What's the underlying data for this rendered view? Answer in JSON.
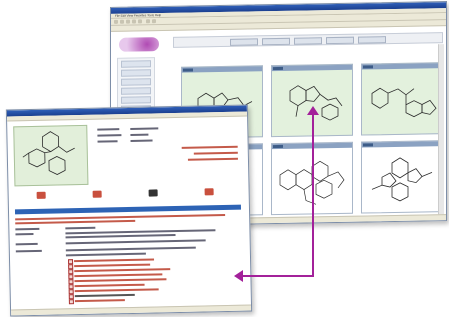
{
  "back_window": {
    "menu": "File   Edit   View   Favorites   Tools   Help"
  },
  "front_window": {},
  "colors": {
    "accent": "#a3219a",
    "titlebar": "#1b3f8f",
    "highlight": "#e3f1dd",
    "link_red": "#c0392b"
  },
  "icons": [
    "back-icon",
    "forward-icon",
    "stop-icon",
    "refresh-icon",
    "home-icon",
    "search-icon",
    "print-icon"
  ]
}
